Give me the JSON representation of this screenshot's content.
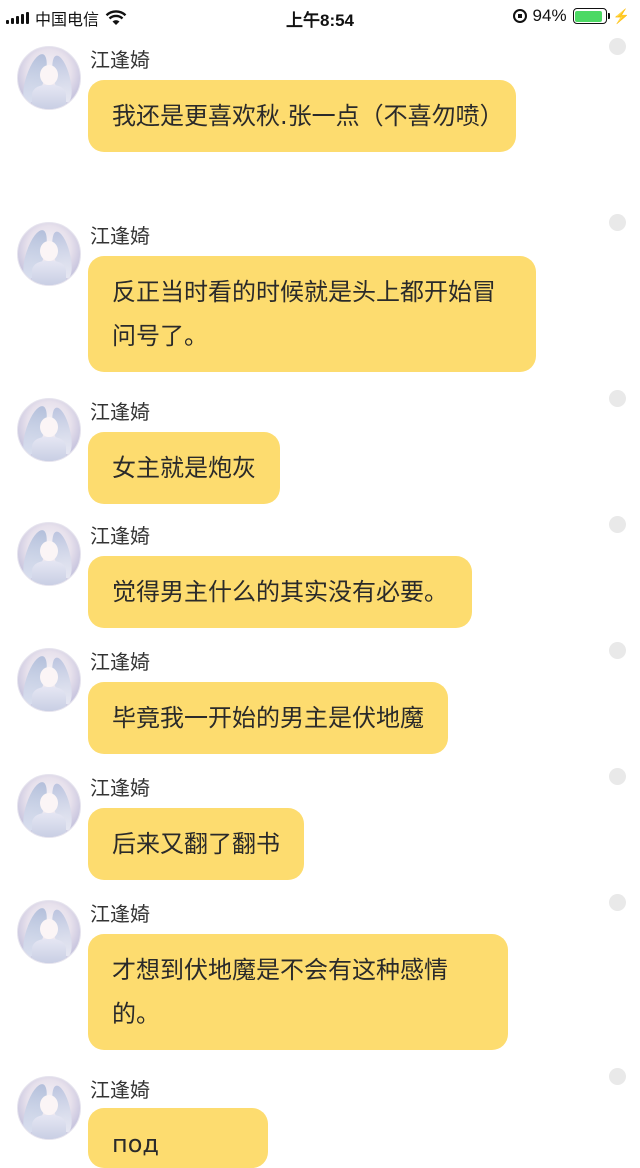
{
  "status_bar": {
    "carrier": "中国电信",
    "time": "上午8:54",
    "battery_percent": "94%",
    "battery_level": 0.94
  },
  "messages": [
    {
      "sender": "江逢婍",
      "text": "我还是更喜欢秋.张一点（不喜勿喷）"
    },
    {
      "sender": "江逢婍",
      "text": "反正当时看的时候就是头上都开始冒问号了。"
    },
    {
      "sender": "江逢婍",
      "text": "女主就是炮灰"
    },
    {
      "sender": "江逢婍",
      "text": "觉得男主什么的其实没有必要。"
    },
    {
      "sender": "江逢婍",
      "text": "毕竟我一开始的男主是伏地魔"
    },
    {
      "sender": "江逢婍",
      "text": "后来又翻了翻书"
    },
    {
      "sender": "江逢婍",
      "text": "才想到伏地魔是不会有这种感情的。"
    },
    {
      "sender": "江逢婍",
      "text": "под"
    }
  ]
}
